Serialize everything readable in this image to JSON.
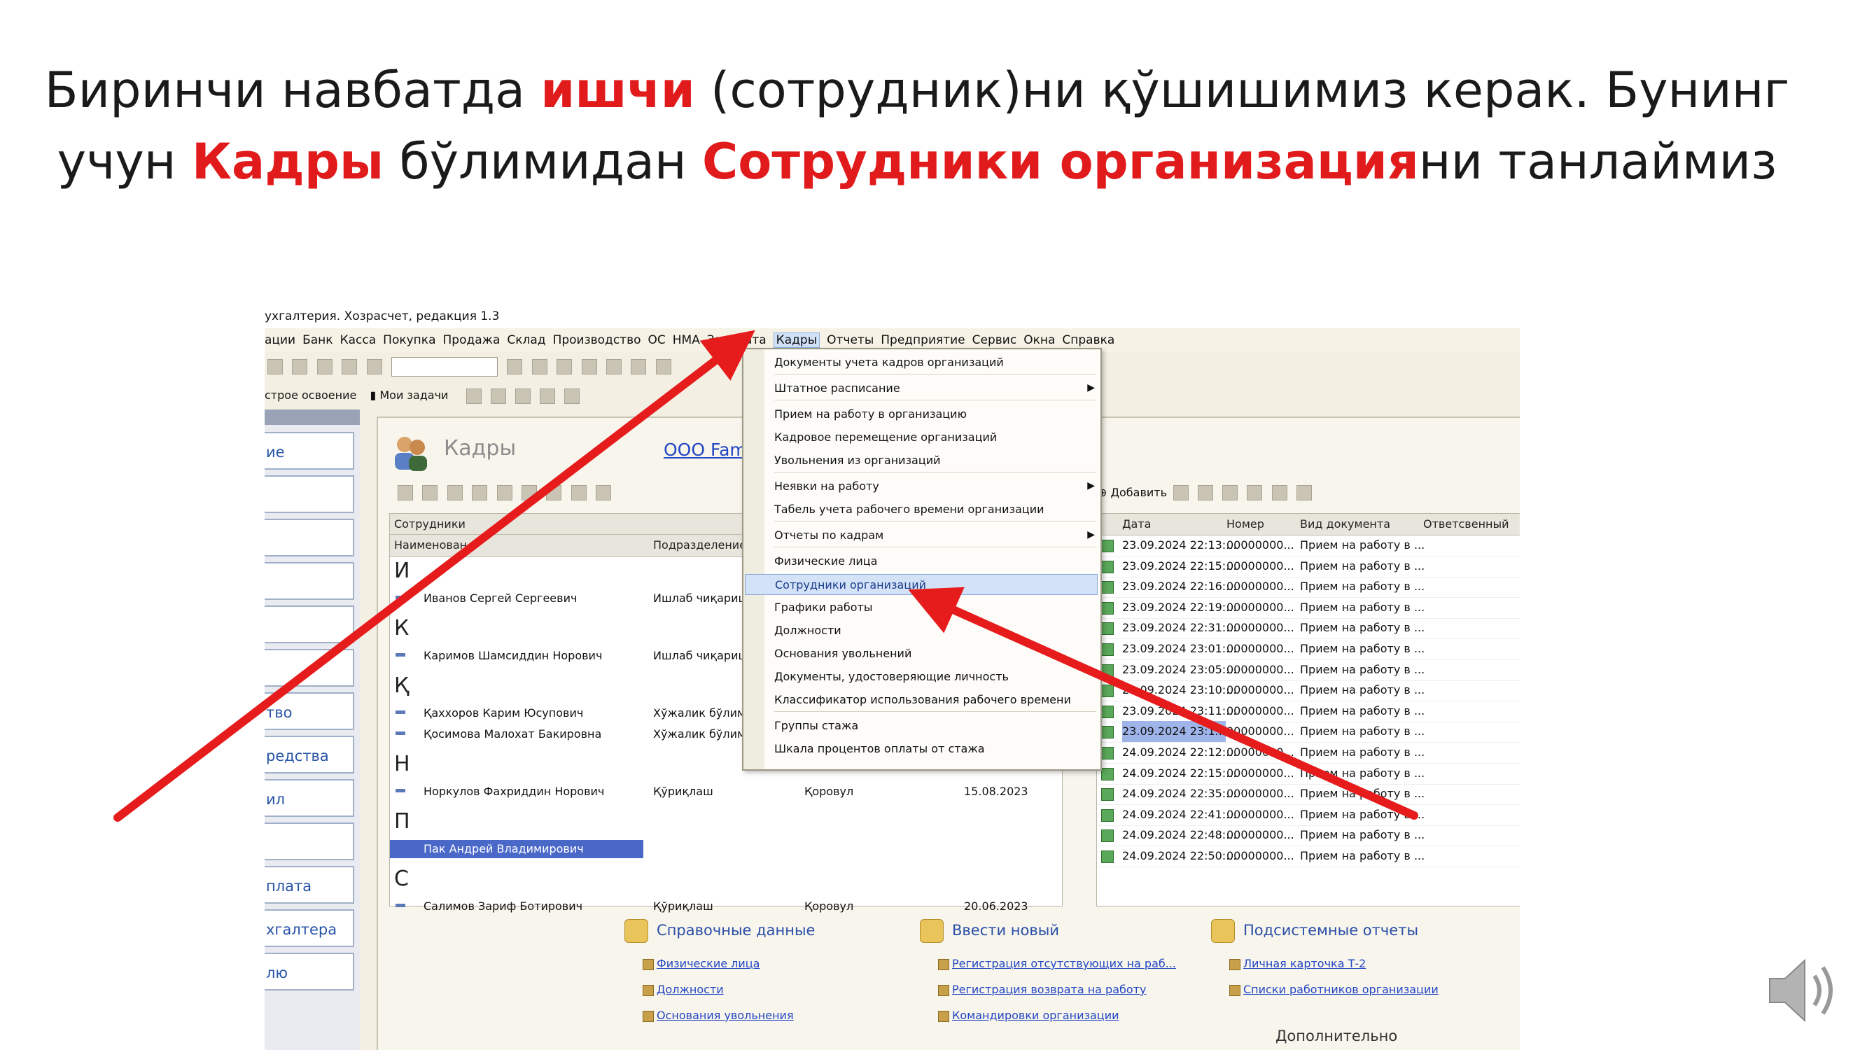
{
  "slide": {
    "title_parts": [
      {
        "text": "Биринчи навбатда ",
        "hl": false
      },
      {
        "text": "ишчи",
        "hl": true
      },
      {
        "text": " (сотрудник)ни қўшишимиз керак. Бунинг учун ",
        "hl": false
      },
      {
        "text": "Кадры",
        "hl": true
      },
      {
        "text": " бўлимидан ",
        "hl": false
      },
      {
        "text": "Сотрудники организация",
        "hl": true
      },
      {
        "text": "ни  танлаймиз",
        "hl": false
      }
    ]
  },
  "colors": {
    "highlight": "#e11b1b",
    "arrow": "#e61c1c",
    "selection": "#4a68c8"
  },
  "app": {
    "window_title": "ухгалтерия. Хозрасчет, редакция 1.3",
    "menu": [
      "ации",
      "Банк",
      "Касса",
      "Покупка",
      "Продажа",
      "Склад",
      "Производство",
      "ОС",
      "НМА",
      "Зарплата",
      "Кадры",
      "Отчеты",
      "Предприятие",
      "Сервис",
      "Окна",
      "Справка"
    ],
    "active_menu": "Кадры",
    "toolbar2": {
      "quick": "строе освоение",
      "tasks": "Мои задачи"
    }
  },
  "left_panel": {
    "items": [
      "ие",
      "",
      "",
      "",
      "",
      "",
      "тво",
      "редства",
      "ил",
      "",
      "плата",
      "хгалтера",
      "лю"
    ]
  },
  "main": {
    "section_title": "Кадры",
    "org_link": "ООО Fami",
    "grid_left": {
      "caption": "Сотрудники",
      "columns": [
        "Наименован",
        "Подразделение"
      ],
      "groups": [
        {
          "letter": "И",
          "rows": [
            {
              "name": "Иванов Сергей Сергеевич",
              "dept": "Ишлаб чиқариш",
              "pos": "",
              "date": ""
            }
          ]
        },
        {
          "letter": "К",
          "rows": [
            {
              "name": "Каримов Шамсиддин Норович",
              "dept": "Ишлаб чиқариш",
              "pos": "",
              "date": ""
            }
          ]
        },
        {
          "letter": "Қ",
          "rows": [
            {
              "name": "Қаххоров Карим Юсупович",
              "dept": "Хўжалик бўлими",
              "pos": "",
              "date": ""
            },
            {
              "name": "Қосимова Малохат Бакировна",
              "dept": "Хўжалик бўлими",
              "pos": "",
              "date": ""
            }
          ]
        },
        {
          "letter": "Н",
          "rows": [
            {
              "name": "Норкулов Фахриддин Норович",
              "dept": "Қўриқлаш",
              "pos": "Қоровул",
              "date": "15.08.2023"
            }
          ]
        },
        {
          "letter": "П",
          "rows": [
            {
              "name": "Пак Андрей Владимирович",
              "dept": "",
              "pos": "",
              "date": ""
            }
          ]
        },
        {
          "letter": "С",
          "rows": [
            {
              "name": "Салимов Зариф Ботирович",
              "dept": "Қўриқлаш",
              "pos": "Қоровул",
              "date": "20.06.2023"
            }
          ]
        }
      ]
    },
    "grid_right": {
      "add_label": "Добавить",
      "columns": [
        "Дата",
        "Номер",
        "Вид документа",
        "Ответсвенный"
      ],
      "rows": [
        {
          "date": "23.09.2024 22:13:...",
          "num": "00000000...",
          "kind": "Прием на работу в ..."
        },
        {
          "date": "23.09.2024 22:15:...",
          "num": "00000000...",
          "kind": "Прием на работу в ..."
        },
        {
          "date": "23.09.2024 22:16:...",
          "num": "00000000...",
          "kind": "Прием на работу в ..."
        },
        {
          "date": "23.09.2024 22:19:...",
          "num": "00000000...",
          "kind": "Прием на работу в ..."
        },
        {
          "date": "23.09.2024 22:31:...",
          "num": "00000000...",
          "kind": "Прием на работу в ..."
        },
        {
          "date": "23.09.2024 23:01:...",
          "num": "00000000...",
          "kind": "Прием на работу в ..."
        },
        {
          "date": "23.09.2024 23:05:...",
          "num": "00000000...",
          "kind": "Прием на работу в ..."
        },
        {
          "date": "23.09.2024 23:10:...",
          "num": "00000000...",
          "kind": "Прием на работу в ..."
        },
        {
          "date": "23.09.2024 23:11:...",
          "num": "00000000...",
          "kind": "Прием на работу в ..."
        },
        {
          "date": "23.09.2024 23:1...",
          "num": "00000000...",
          "kind": "Прием на работу в ..."
        },
        {
          "date": "24.09.2024 22:12:...",
          "num": "00000000...",
          "kind": "Прием на работу в ..."
        },
        {
          "date": "24.09.2024 22:15:...",
          "num": "00000000...",
          "kind": "Прием на работу в ..."
        },
        {
          "date": "24.09.2024 22:35:...",
          "num": "00000000...",
          "kind": "Прием на работу в ..."
        },
        {
          "date": "24.09.2024 22:41:...",
          "num": "00000000...",
          "kind": "Прием на работу в ..."
        },
        {
          "date": "24.09.2024 22:48:...",
          "num": "00000000...",
          "kind": "Прием на работу в ..."
        },
        {
          "date": "24.09.2024 22:50:...",
          "num": "00000000...",
          "kind": "Прием на работу в ..."
        }
      ]
    }
  },
  "dropdown": {
    "items": [
      {
        "label": "Документы учета кадров организаций",
        "sub": false,
        "sep_after": true
      },
      {
        "label": "Штатное расписание",
        "sub": true,
        "sep_after": true
      },
      {
        "label": "Прием на работу в организацию",
        "sub": false,
        "sep_after": false
      },
      {
        "label": "Кадровое перемещение организаций",
        "sub": false,
        "sep_after": false
      },
      {
        "label": "Увольнения из организаций",
        "sub": false,
        "sep_after": true
      },
      {
        "label": "Неявки на работу",
        "sub": true,
        "sep_after": false
      },
      {
        "label": "Табель учета рабочего времени организации",
        "sub": false,
        "sep_after": true
      },
      {
        "label": "Отчеты по кадрам",
        "sub": true,
        "sep_after": true
      },
      {
        "label": "Физические лица",
        "sub": false,
        "sep_after": false
      },
      {
        "label": "Сотрудники организаций",
        "sub": false,
        "sep_after": false,
        "selected": true
      },
      {
        "label": "Графики работы",
        "sub": false,
        "sep_after": false
      },
      {
        "label": "Должности",
        "sub": false,
        "sep_after": false
      },
      {
        "label": "Основания увольнений",
        "sub": false,
        "sep_after": false
      },
      {
        "label": "Документы, удостоверяющие личность",
        "sub": false,
        "sep_after": false
      },
      {
        "label": "Классификатор использования рабочего времени",
        "sub": false,
        "sep_after": true
      },
      {
        "label": "Группы стажа",
        "sub": false,
        "sep_after": false
      },
      {
        "label": "Шкала процентов оплаты от стажа",
        "sub": false,
        "sep_after": false
      }
    ]
  },
  "bottom": {
    "blocks": [
      {
        "title": "Справочные данные",
        "links": [
          "Физические лица",
          "Должности",
          "Основания увольнения"
        ]
      },
      {
        "title": "Ввести новый",
        "links": [
          "Регистрация отсутствующих на раб...",
          "Регистрация возврата на работу",
          "Командировки организации"
        ]
      },
      {
        "title": "Подсистемные отчеты",
        "links": [
          "Личная карточка Т-2",
          "Списки работников организации"
        ]
      }
    ],
    "extra": "Дополнительно"
  }
}
